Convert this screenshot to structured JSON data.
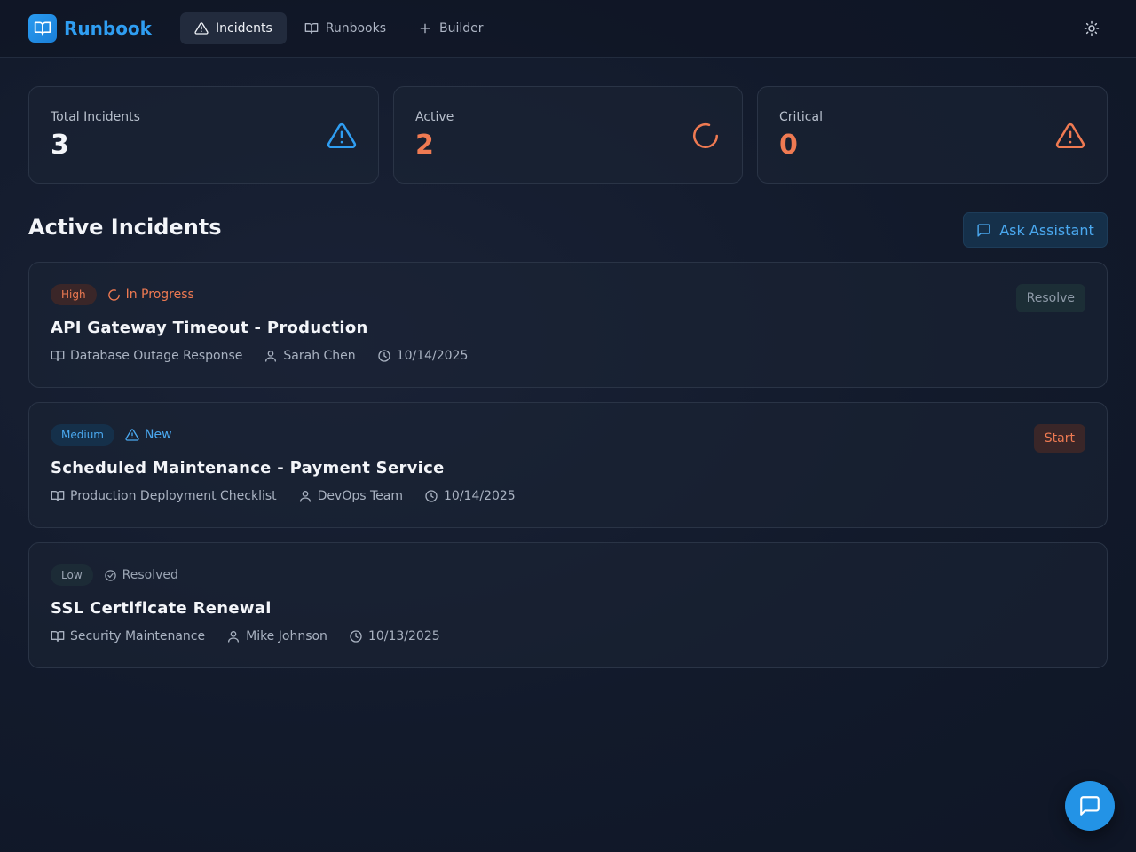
{
  "app": {
    "name": "Runbook",
    "icon": "book-open-icon"
  },
  "nav": [
    {
      "label": "Incidents",
      "icon": "alert-triangle-icon",
      "active": true
    },
    {
      "label": "Runbooks",
      "icon": "book-open-icon",
      "active": false
    },
    {
      "label": "Builder",
      "icon": "plus-icon",
      "active": false
    }
  ],
  "theme_toggle": {
    "icon": "sun-icon"
  },
  "stats": [
    {
      "label": "Total Incidents",
      "value": "3",
      "icon": "alert-triangle-icon",
      "color": "#2f9ef2"
    },
    {
      "label": "Active",
      "value": "2",
      "icon": "loader-icon",
      "color": "#ef7a52"
    },
    {
      "label": "Critical",
      "value": "0",
      "icon": "alert-triangle-icon",
      "color": "#ef7a52"
    }
  ],
  "section": {
    "title": "Active Incidents",
    "ask_label": "Ask Assistant"
  },
  "incidents": [
    {
      "severity": "High",
      "status": "In Progress",
      "title": "API Gateway Timeout - Production",
      "runbook": "Database Outage Response",
      "assignee": "Sarah Chen",
      "date": "10/14/2025",
      "action": "Resolve"
    },
    {
      "severity": "Medium",
      "status": "New",
      "title": "Scheduled Maintenance - Payment Service",
      "runbook": "Production Deployment Checklist",
      "assignee": "DevOps Team",
      "date": "10/14/2025",
      "action": "Start"
    },
    {
      "severity": "Low",
      "status": "Resolved",
      "title": "SSL Certificate Renewal",
      "runbook": "Security Maintenance",
      "assignee": "Mike Johnson",
      "date": "10/13/2025",
      "action": ""
    }
  ],
  "colors": {
    "accent": "#2f9ef2",
    "warning": "#ef7a52",
    "background": "#121a2b"
  }
}
